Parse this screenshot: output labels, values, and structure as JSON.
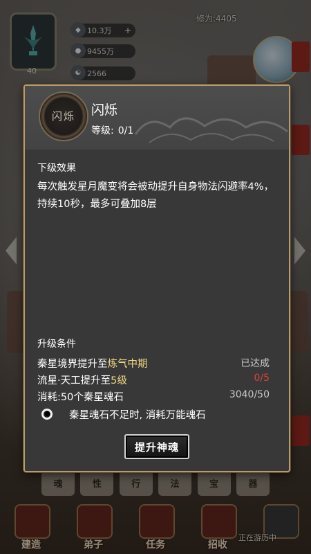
{
  "hud": {
    "player_level": "40",
    "resources": [
      {
        "icon": "gem-icon",
        "value": "10.3万"
      },
      {
        "icon": "spirit-orb-icon",
        "value": "9455万"
      },
      {
        "icon": "yin-yang-icon",
        "value": "2566"
      }
    ],
    "cultivation": "修为:4405"
  },
  "modal": {
    "skill_icon_text": "闪烁",
    "skill_name": "闪烁",
    "level_label": "等级:",
    "level_value": "0/1",
    "effect_title": "下级效果",
    "effect_text": "每次触发星月魔变将会被动提升自身物法闪避率4%，持续10秒，最多可叠加8层",
    "conditions_title": "升级条件",
    "conditions": [
      {
        "prefix": "秦星境界提升至",
        "highlight": "炼气中期",
        "status": "已达成",
        "status_color": "#c9c9c9"
      },
      {
        "prefix": "流星·天工提升至",
        "highlight": "5级",
        "status": "0/5",
        "status_color": "#d8463a"
      },
      {
        "prefix": "消耗:50个秦星魂石",
        "highlight": "",
        "status": "3040/50",
        "status_color": "#c9c9c9"
      }
    ],
    "auto_use_label": "秦星魂石不足时, 消耗万能魂石",
    "upgrade_button": "提升神魂"
  },
  "tabs": [
    "魂",
    "性",
    "行",
    "法",
    "宝",
    "器"
  ],
  "bottom_nav": [
    "建造",
    "弟子",
    "任务",
    "招收"
  ],
  "travel_status": "正在游历中",
  "colors": {
    "highlight": "#f1d782",
    "unmet": "#d8463a",
    "frame": "#b89c6c"
  }
}
